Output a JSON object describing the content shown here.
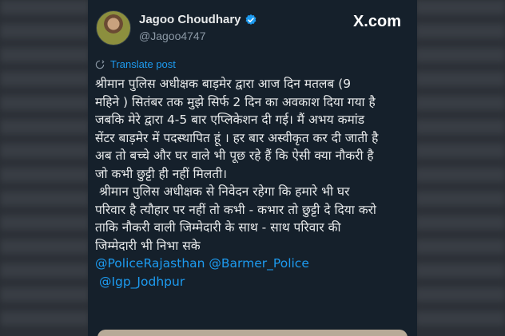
{
  "tweet": {
    "author_name": "Jagoo Choudhary",
    "handle": "@Jagoo4747",
    "brand": "X.com",
    "translate_label": "Translate post",
    "body_lines": [
      "श्रीमान पुलिस अधीक्षक बाड़मेर द्वारा आज दिन मतलब (9",
      "महिने ) सितंबर तक मुझे सिर्फ 2 दिन का अवकाश दिया गया है",
      "जबकि मेरे द्वारा 4-5 बार एप्लिकेशन दी गई। मैं अभय कमांड",
      "सेंटर बाड़मेर में पदस्थापित हूं । हर बार अस्वीकृत कर दी जाती है",
      "अब तो बच्चे और घर वाले भी पूछ रहे हैं कि ऐसी क्या नौकरी है",
      "जो कभी छुट्टी ही नहीं मिलती।",
      " श्रीमान पुलिस अधीक्षक से निवेदन रहेगा कि हमारे भी घर",
      "परिवार है त्यौहार पर नहीं तो कभी - कभार तो छुट्टी दे दिया करो",
      "ताकि नौकरी वाली जिम्मेदारी के साथ - साथ परिवार की",
      "जिम्मेदारी भी निभा सके"
    ],
    "mentions": [
      "@PoliceRajasthan",
      "@Barmer_Police",
      "@Igp_Jodhpur"
    ],
    "colors": {
      "background": "#15202b",
      "text": "#e7e9ea",
      "accent": "#1d9bf0",
      "muted": "#8b98a5"
    }
  }
}
